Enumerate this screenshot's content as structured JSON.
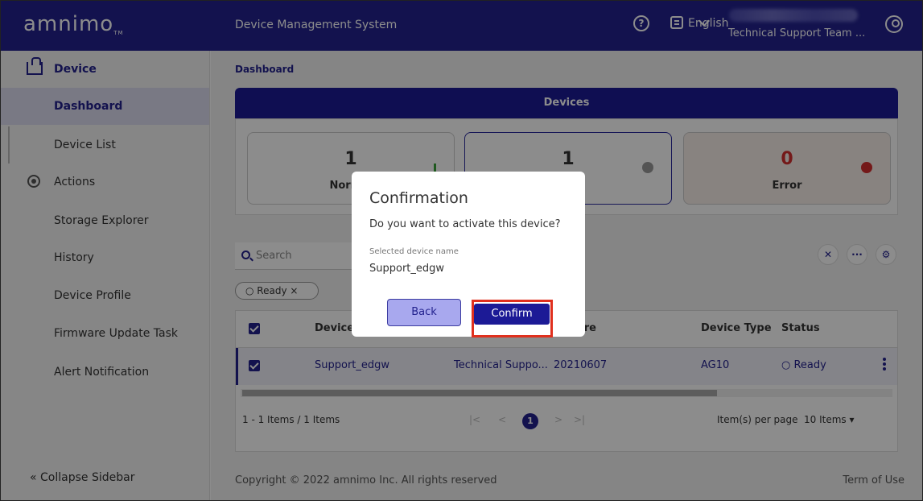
{
  "header": {
    "logo": "amnimo",
    "logo_tm": "TM",
    "app_name": "Device Management System",
    "help_icon": "?",
    "language": "English",
    "team": "Technical Support Team ..."
  },
  "sidebar": {
    "section_device": "Device",
    "items_device": [
      "Dashboard",
      "Device List"
    ],
    "section_actions": "Actions",
    "items_actions": [
      "Storage Explorer",
      "History",
      "Device Profile",
      "Firmware Update Task",
      "Alert Notification"
    ],
    "collapse": "Collapse Sidebar"
  },
  "main": {
    "breadcrumb": "Dashboard",
    "devices_header": "Devices",
    "cards": [
      {
        "count": "1",
        "label": "Normal"
      },
      {
        "count": "1",
        "label": ""
      },
      {
        "count": "0",
        "label": "Error"
      }
    ],
    "search_placeholder": "Search",
    "filter_chip": "○ Ready ×",
    "table": {
      "columns": [
        "Device",
        "are",
        "Device Type",
        "Status"
      ],
      "rows": [
        {
          "name": "Support_edgw",
          "group": "Technical Suppo...",
          "firmware": "20210607",
          "type": "AG10",
          "status": "○ Ready"
        }
      ]
    },
    "pager": {
      "summary": "1 - 1 Items / 1 Items",
      "current_page": "1",
      "per_page_label": "Item(s) per page",
      "per_page_value": "10 Items"
    },
    "footer": "Copyright © 2022 amnimo Inc. All rights reserved",
    "term": "Term of Use"
  },
  "modal": {
    "title": "Confirmation",
    "question": "Do you want to activate this device?",
    "field_label": "Selected device name",
    "field_value": "Support_edgw",
    "back_label": "Back",
    "confirm_label": "Confirm"
  },
  "colors": {
    "brand": "#23228e",
    "normal": "#39a23a",
    "error": "#d32f2f",
    "highlight": "#e0301e"
  }
}
